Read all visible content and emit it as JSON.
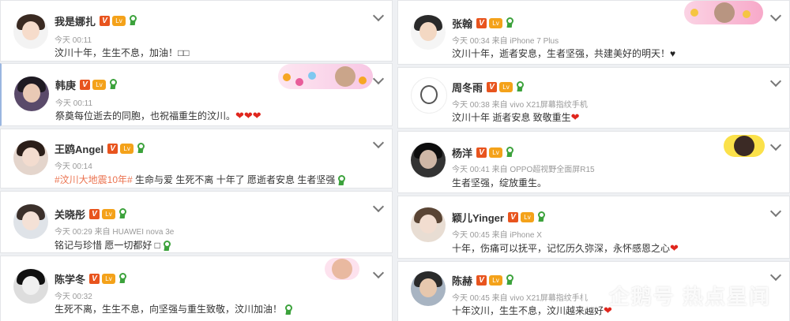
{
  "colors": {
    "vip_badge": "#e8541e",
    "level_badge": "#f4a21a",
    "ribbon": "#3ca23c",
    "hashtag": "#eb7350",
    "heart": "#e0261d"
  },
  "badges": {
    "vip_glyph": "V",
    "level_glyph": "Lv"
  },
  "left": [
    {
      "name": "我是娜扎",
      "meta": "今天 00:11",
      "text": "汶川十年，生生不息，加油！□□"
    },
    {
      "name": "韩庚",
      "meta": "今天 00:11",
      "text": "祭奠每位逝去的同胞，也祝福重生的汶川。",
      "emoji": "❤❤❤"
    },
    {
      "name": "王鸥Angel",
      "meta": "今天 00:14",
      "hashtag": "#汶川大地震10年#",
      "text": " 生命与爱 生死不离 十年了 愿逝者安息 生者坚强"
    },
    {
      "name": "关晓彤",
      "meta": "今天 00:29 来自 HUAWEI nova 3e",
      "text": "铭记与珍惜 愿一切都好 □"
    },
    {
      "name": "陈学冬",
      "meta": "今天 00:32",
      "text": "生死不离，生生不息，向坚强与重生致敬，汶川加油！"
    }
  ],
  "right": [
    {
      "name": "张翰",
      "meta": "今天 00:34 来自 iPhone 7 Plus",
      "text": "汶川十年，逝者安息，生者坚强，共建美好的明天！",
      "emoji": "♥"
    },
    {
      "name": "周冬雨",
      "meta": "今天 00:38 来自 vivo X21屏幕指纹手机",
      "text": "汶川十年 逝者安息 致敬重生",
      "emoji": "❤"
    },
    {
      "name": "杨洋",
      "meta": "今天 00:41 来自 OPPO超视野全面屏R15",
      "text": "生者坚强，绽放重生。"
    },
    {
      "name": "颖儿Yinger",
      "meta": "今天 00:45 来自 iPhone X",
      "text": "十年，伤痛可以抚平，记忆历久弥深，永怀感恩之心",
      "emoji": "❤"
    },
    {
      "name": "陈赫",
      "meta": "今天 00:45 来自 vivo X21屏幕指纹手机",
      "text": "十年汶川，生生不息，汶川越来越好",
      "emoji": "❤"
    }
  ],
  "watermark": "企鹅号 热点星闻"
}
